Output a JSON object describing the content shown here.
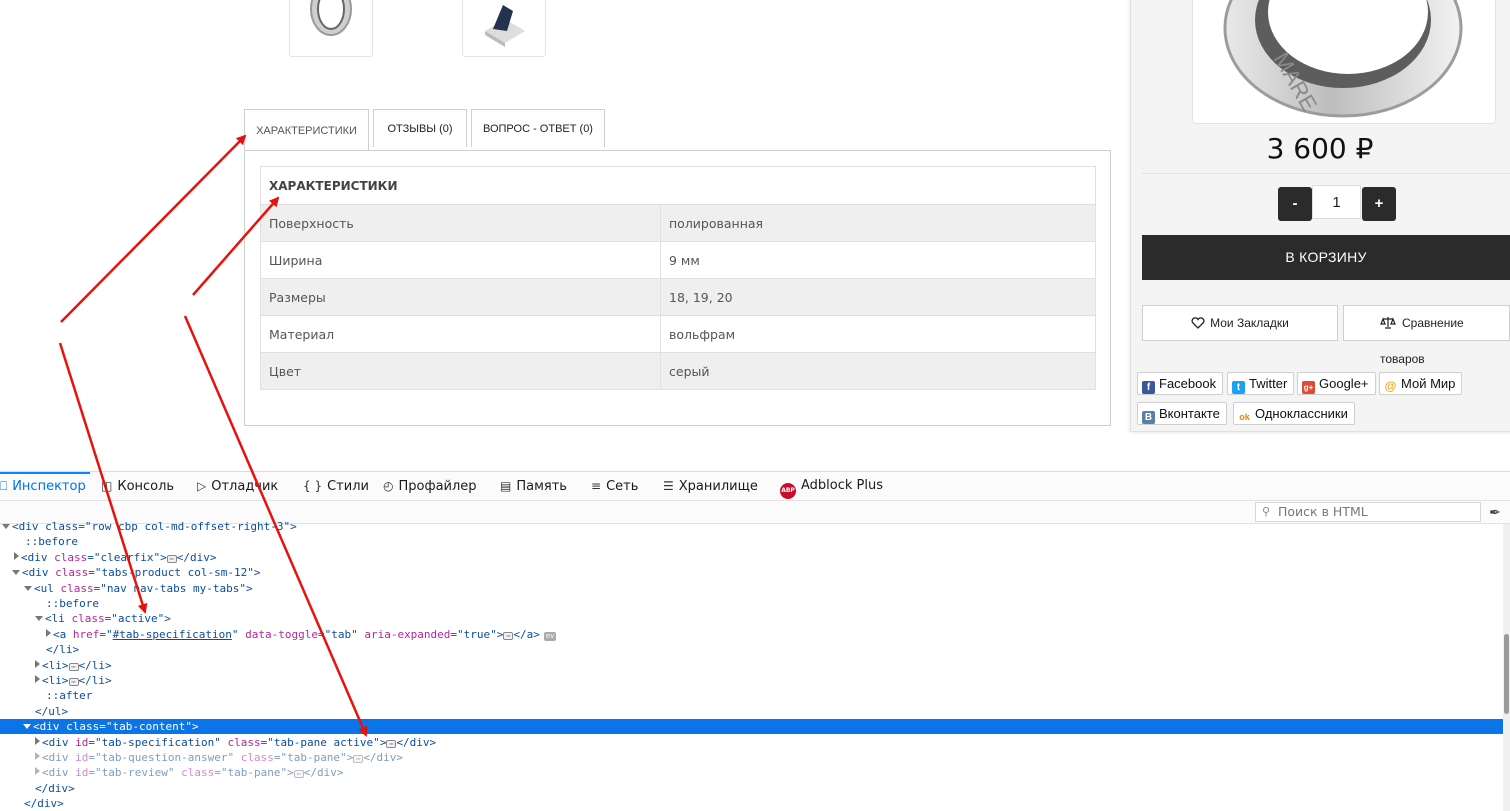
{
  "tabs": [
    {
      "label": "ХАРАКТЕРИСТИКИ",
      "active": true
    },
    {
      "label": "ОТЗЫВЫ (0)",
      "active": false
    },
    {
      "label": "ВОПРОС - ОТВЕТ (0)",
      "active": false
    }
  ],
  "spec": {
    "heading": "ХАРАКТЕРИСТИКИ",
    "rows": [
      {
        "name": "Поверхность",
        "value": "полированная"
      },
      {
        "name": "Ширина",
        "value": "9 мм"
      },
      {
        "name": "Размеры",
        "value": "18, 19, 20"
      },
      {
        "name": "Материал",
        "value": "вольфрам"
      },
      {
        "name": "Цвет",
        "value": "серый"
      }
    ]
  },
  "product": {
    "price": "3 600 ₽",
    "qty_minus": "-",
    "qty_value": "1",
    "qty_plus": "+",
    "cart_label": "В КОРЗИНУ",
    "bookmarks_label": "Мои Закладки",
    "compare_label": "Сравнение товаров",
    "ring_engraving": "MARE"
  },
  "share": [
    {
      "label": "Facebook",
      "icon": "f",
      "color": "#3b5998"
    },
    {
      "label": "Twitter",
      "icon": "t",
      "color": "#1da1f2"
    },
    {
      "label": "Google+",
      "icon": "g+",
      "color": "#dd4b39"
    },
    {
      "label": "Мой Мир",
      "icon": "@",
      "color": "#f5a623"
    },
    {
      "label": "Вконтакте",
      "icon": "B",
      "color": "#5b7fa6"
    },
    {
      "label": "Одноклассники",
      "icon": "ok",
      "color": "#ee8208"
    }
  ],
  "devtools": {
    "tabs": [
      {
        "label": "Инспектор",
        "icon": "inspector-icon",
        "active": true
      },
      {
        "label": "Консоль",
        "icon": "console-icon"
      },
      {
        "label": "Отладчик",
        "icon": "debugger-icon"
      },
      {
        "label": "Стили",
        "icon": "{ }"
      },
      {
        "label": "Профайлер",
        "icon": "profiler-icon"
      },
      {
        "label": "Память",
        "icon": "memory-icon"
      },
      {
        "label": "Сеть",
        "icon": "network-icon"
      },
      {
        "label": "Хранилище",
        "icon": "storage-icon"
      },
      {
        "label": "Adblock Plus",
        "icon": "ABP"
      }
    ],
    "search_placeholder": "Поиск в HTML",
    "markup": {
      "l0": "<div class=\"row cbp col-md-offset-right-3\">",
      "l1": "::before",
      "l2_tag": "<div ",
      "l2_attr": "class",
      "l2_val": "\"clearfix\"",
      "l2_end": "</div>",
      "l3_tag": "<div ",
      "l3_attr": "class",
      "l3_val": "\"tabs-product col-sm-12\"",
      "l4_tag": "<ul ",
      "l4_attr": "class",
      "l4_val": "\"nav nav-tabs my-tabs\"",
      "l5": "::before",
      "l6_tag": "<li ",
      "l6_attr": "class",
      "l6_val": "\"active\"",
      "l7_tag": "<a ",
      "l7_a1": "href",
      "l7_v1": "#tab-specification",
      "l7_a2": "data-toggle",
      "l7_v2": "\"tab\"",
      "l7_a3": "aria-expanded",
      "l7_v3": "\"true\"",
      "l7_end": "</a>",
      "l7_ev": "ev",
      "l8": "</li>",
      "l9_open": "<li>",
      "l9_close": "</li>",
      "l10_open": "<li>",
      "l10_close": "</li>",
      "l11": "::after",
      "l12": "</ul>",
      "l13": "<div class=\"tab-content\">",
      "l14_tag": "<div ",
      "l14_a1": "id",
      "l14_v1": "\"tab-specification\"",
      "l14_a2": "class",
      "l14_v2": "\"tab-pane active\"",
      "l14_end": "</div>",
      "l15_tag": "<div ",
      "l15_a1": "id",
      "l15_v1": "\"tab-question-answer\"",
      "l15_a2": "class",
      "l15_v2": "\"tab-pane\"",
      "l15_end": "</div>",
      "l16_tag": "<div ",
      "l16_a1": "id",
      "l16_v1": "\"tab-review\"",
      "l16_a2": "class",
      "l16_v2": "\"tab-pane\"",
      "l16_end": "</div>",
      "l17": "</div>",
      "l18": "</div>"
    }
  },
  "colors": {
    "annotation_arrow": "#e8120c",
    "devtools_selection": "#0a74e8",
    "dark_button": "#2b2b2b"
  }
}
